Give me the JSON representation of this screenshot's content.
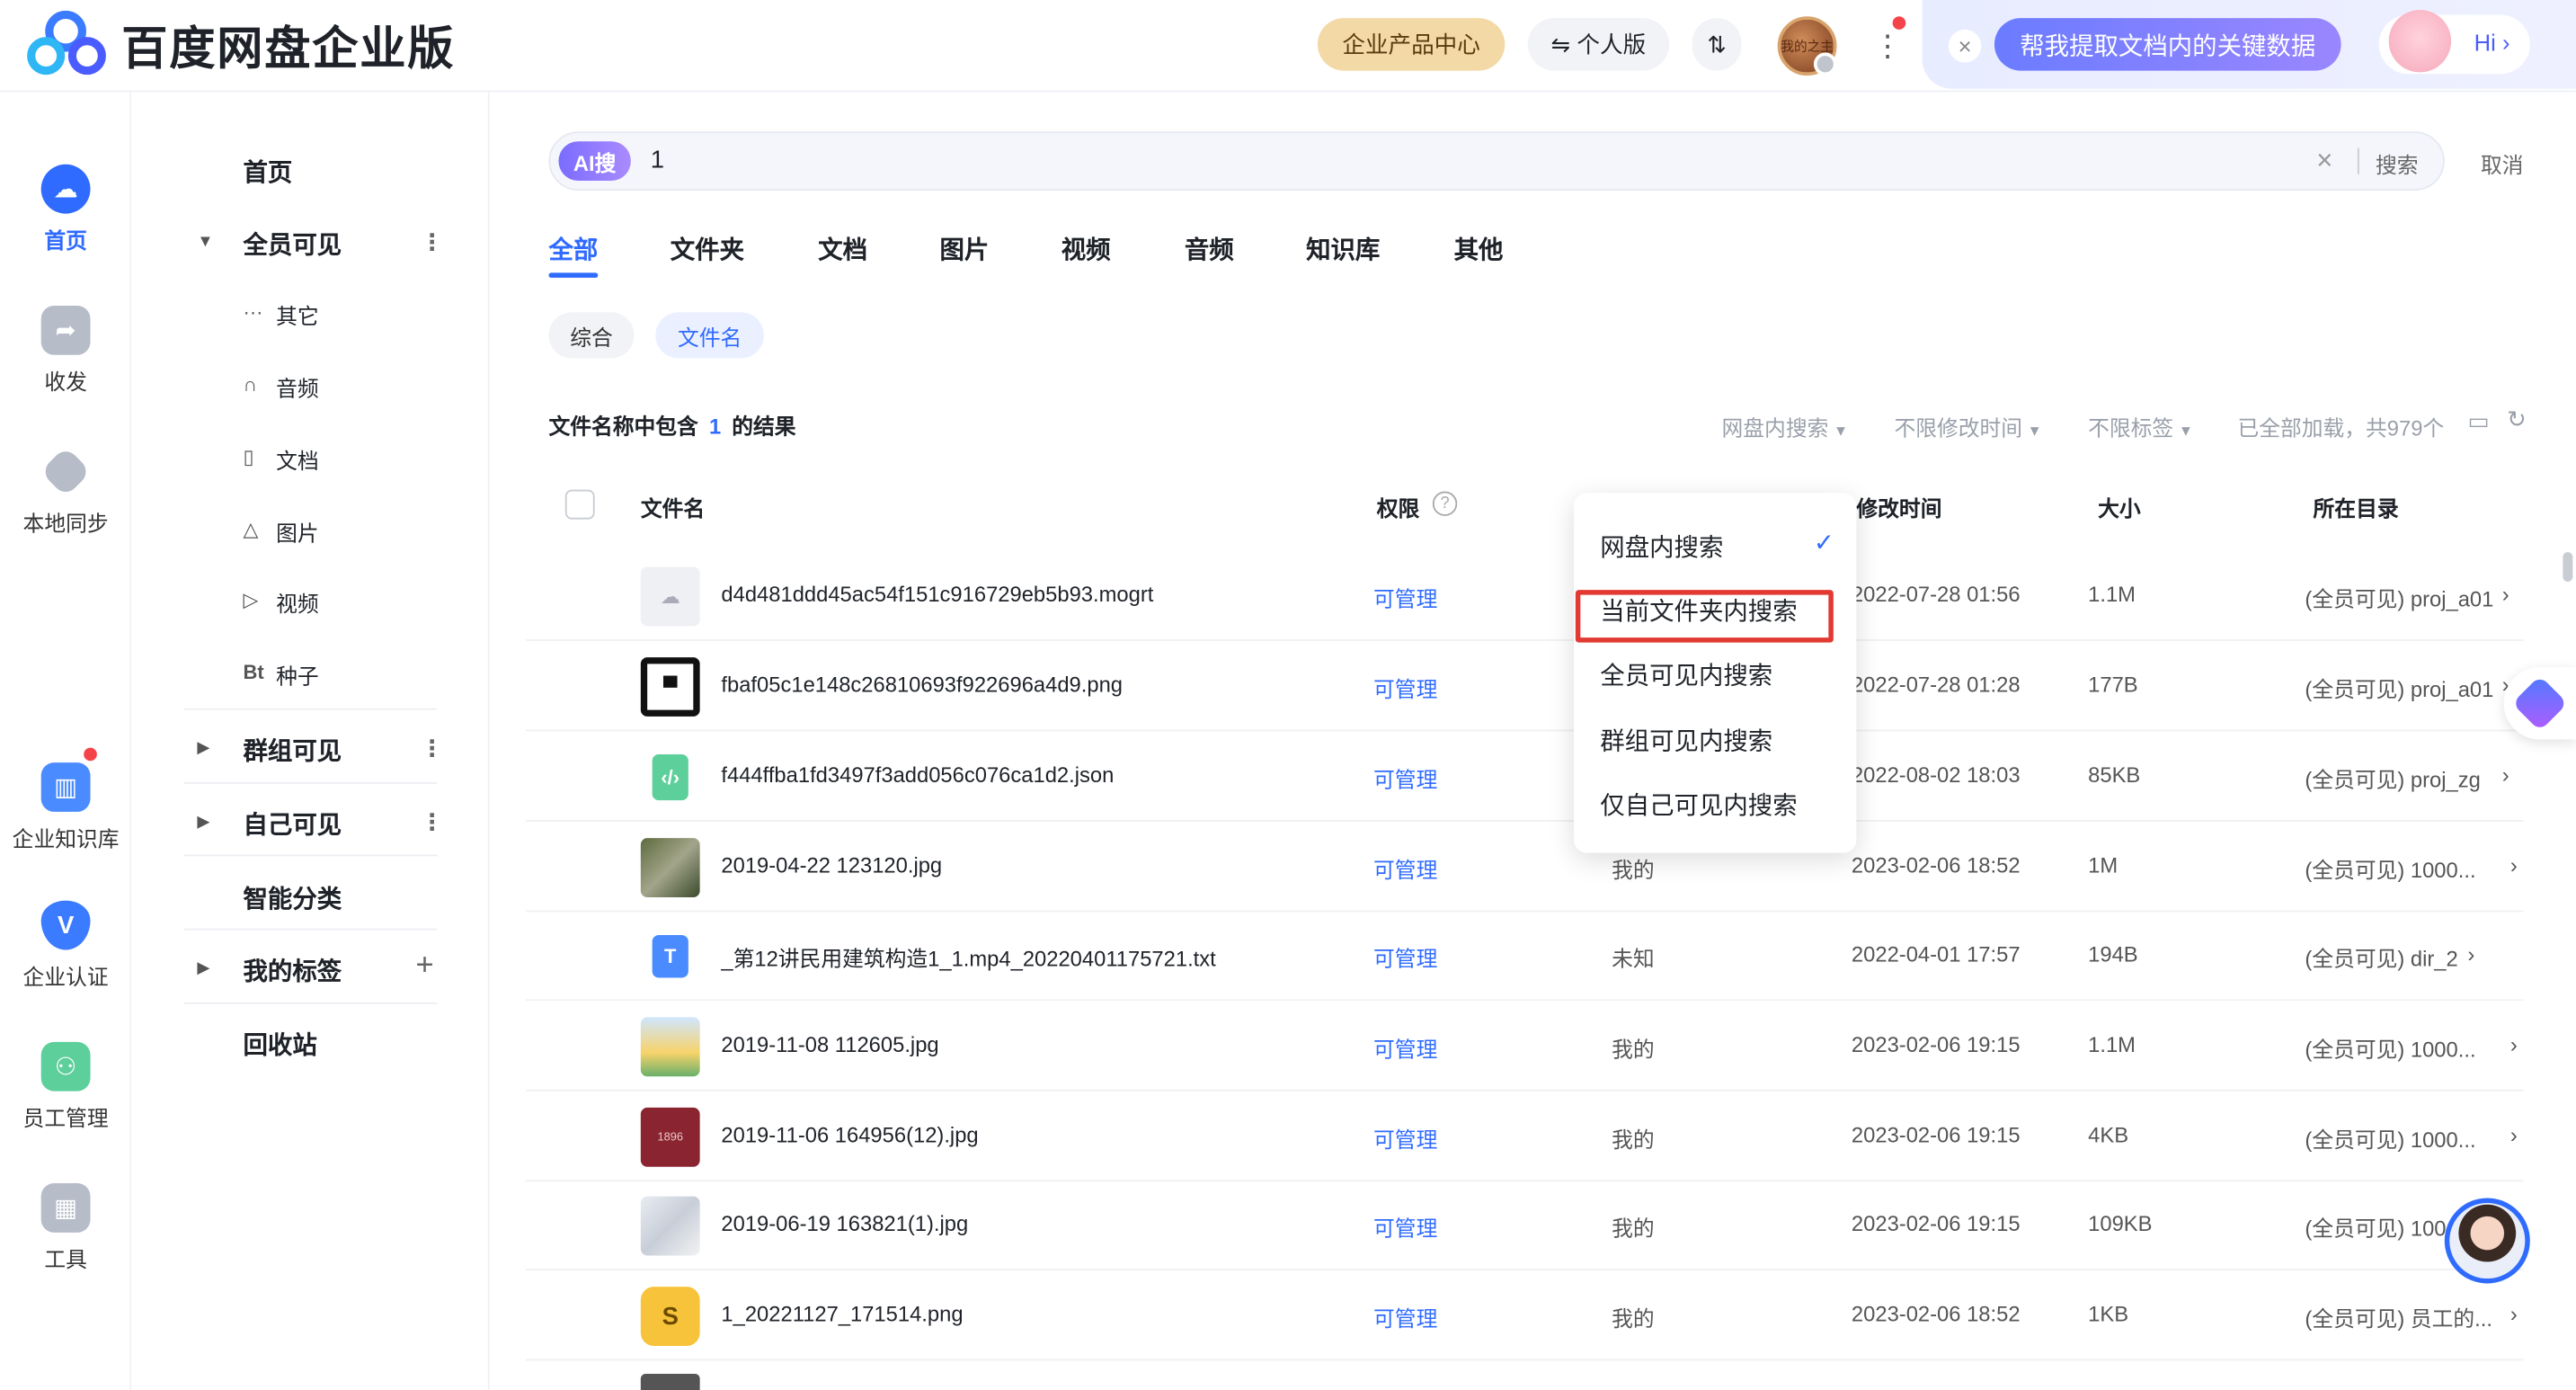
{
  "header": {
    "app_title": "百度网盘企业版",
    "products_label": "企业产品中心",
    "personal_label": "个人版",
    "sort_label": "⇅",
    "avatar_text": "我的之主",
    "ai_prompt": "帮我提取文档内的关键数据",
    "ai_hi": "Hi ›"
  },
  "rail": [
    {
      "label": "首页",
      "icon": "cloud-icon",
      "active": true
    },
    {
      "label": "收发",
      "icon": "share-folder-icon"
    },
    {
      "label": "本地同步",
      "icon": "sync-icon"
    },
    {
      "label": "企业知识库",
      "icon": "book-icon"
    },
    {
      "label": "企业认证",
      "icon": "verify-shield-icon"
    },
    {
      "label": "员工管理",
      "icon": "people-icon"
    },
    {
      "label": "工具",
      "icon": "grid-tools-icon"
    }
  ],
  "nav": {
    "home": "首页",
    "all_visible": "全员可见",
    "sub_items": [
      {
        "icon": "···",
        "label": "其它"
      },
      {
        "icon": "∩",
        "label": "音频"
      },
      {
        "icon": "▯",
        "label": "文档"
      },
      {
        "icon": "△",
        "label": "图片"
      },
      {
        "icon": "▷",
        "label": "视频"
      },
      {
        "icon": "Bt",
        "label": "种子"
      }
    ],
    "group_visible": "群组可见",
    "self_visible": "自己可见",
    "smart_category": "智能分类",
    "my_tags": "我的标签",
    "recycle": "回收站"
  },
  "search": {
    "ai_badge": "AI搜",
    "query": "1",
    "clear": "×",
    "search_btn": "搜索",
    "cancel": "取消"
  },
  "tabs": [
    "全部",
    "文件夹",
    "文档",
    "图片",
    "视频",
    "音频",
    "知识库",
    "其他"
  ],
  "chips": [
    "综合",
    "文件名"
  ],
  "results": {
    "title_prefix": "文件名称中包含",
    "keyword": "1",
    "title_suffix": "的结果",
    "filter_scope": "网盘内搜索",
    "filter_time": "不限修改时间",
    "filter_tag": "不限标签",
    "loaded": "已全部加载，共979个"
  },
  "columns": {
    "name": "文件名",
    "perm": "权限",
    "time": "修改时间",
    "size": "大小",
    "dir": "所在目录"
  },
  "dropdown": {
    "items": [
      "网盘内搜索",
      "当前文件夹内搜索",
      "全员可见内搜索",
      "群组可见内搜索",
      "仅自己可见内搜索"
    ],
    "selected": "网盘内搜索",
    "check": "✓"
  },
  "rows": [
    {
      "name": "d4d481ddd45ac54f151c916729eb5b93.mogrt",
      "perm": "可管理",
      "owner": "",
      "time": "2022-07-28 01:56",
      "size": "1.1M",
      "dir": "(全员可见) proj_a01",
      "icon": "cloud-file-icon"
    },
    {
      "name": "fbaf05c1e148c26810693f922696a4d9.png",
      "perm": "可管理",
      "owner": "",
      "time": "2022-07-28 01:28",
      "size": "177B",
      "dir": "(全员可见) proj_a01",
      "icon": "image-thumb-icon"
    },
    {
      "name": "f444ffba1fd3497f3add056c076ca1d2.json",
      "perm": "可管理",
      "owner": "",
      "time": "2022-08-02 18:03",
      "size": "85KB",
      "dir": "(全员可见) proj_zg",
      "icon": "code-file-icon"
    },
    {
      "name": "2019-04-22 123120.jpg",
      "perm": "可管理",
      "owner": "我的",
      "time": "2023-02-06 18:52",
      "size": "1M",
      "dir": "(全员可见) 1000...",
      "icon": "photo-thumb-icon"
    },
    {
      "name": "_第12讲民用建筑构造1_1.mp4_20220401175721.txt",
      "perm": "可管理",
      "owner": "未知",
      "time": "2022-04-01 17:57",
      "size": "194B",
      "dir": "(全员可见) dir_2",
      "icon": "text-file-icon"
    },
    {
      "name": "2019-11-08 112605.jpg",
      "perm": "可管理",
      "owner": "我的",
      "time": "2023-02-06 19:15",
      "size": "1.1M",
      "dir": "(全员可见) 1000...",
      "icon": "photo-thumb-icon"
    },
    {
      "name": "2019-11-06 164956(12).jpg",
      "perm": "可管理",
      "owner": "我的",
      "time": "2023-02-06 19:15",
      "size": "4KB",
      "dir": "(全员可见) 1000...",
      "icon": "photo-thumb-icon"
    },
    {
      "name": "2019-06-19 163821(1).jpg",
      "perm": "可管理",
      "owner": "我的",
      "time": "2023-02-06 19:15",
      "size": "109KB",
      "dir": "(全员可见) 100",
      "icon": "photo-thumb-icon"
    },
    {
      "name": "1_20221127_171514.png",
      "perm": "可管理",
      "owner": "我的",
      "time": "2023-02-06 18:52",
      "size": "1KB",
      "dir": "(全员可见) 员工的...",
      "icon": "image-thumb-icon"
    }
  ],
  "colors": {
    "accent": "#2f6bff",
    "highlight_border": "#e23a32",
    "products_bg": "#f3d9a6"
  }
}
